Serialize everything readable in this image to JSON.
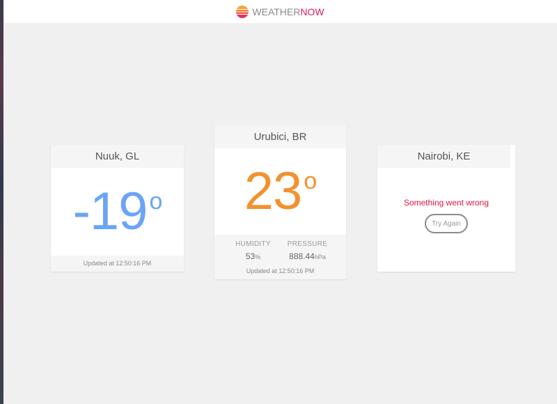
{
  "app": {
    "brand_part1": "WEATHER",
    "brand_part2": "NOW",
    "logo_icon": "sunset-icon",
    "accent_color": "#e5195c"
  },
  "cards": [
    {
      "city": "Nuuk, GL",
      "temperature": "-19",
      "degree_symbol": "o",
      "temp_color": "#6aa4f7",
      "updated": "Updated at 12:50:16 PM"
    },
    {
      "city": "Urubici, BR",
      "temperature": "23",
      "degree_symbol": "o",
      "temp_color": "#f2922f",
      "humidity_label": "HUMIDITY",
      "humidity_value": "53",
      "humidity_unit": "%",
      "pressure_label": "PRESSURE",
      "pressure_value": "888.44",
      "pressure_unit": "hPa",
      "updated": "Updated at 12:50:16 PM"
    },
    {
      "city": "Nairobi, KE",
      "error": "Something went wrong",
      "error_color": "#e3143f",
      "retry_label": "Try Again"
    }
  ]
}
